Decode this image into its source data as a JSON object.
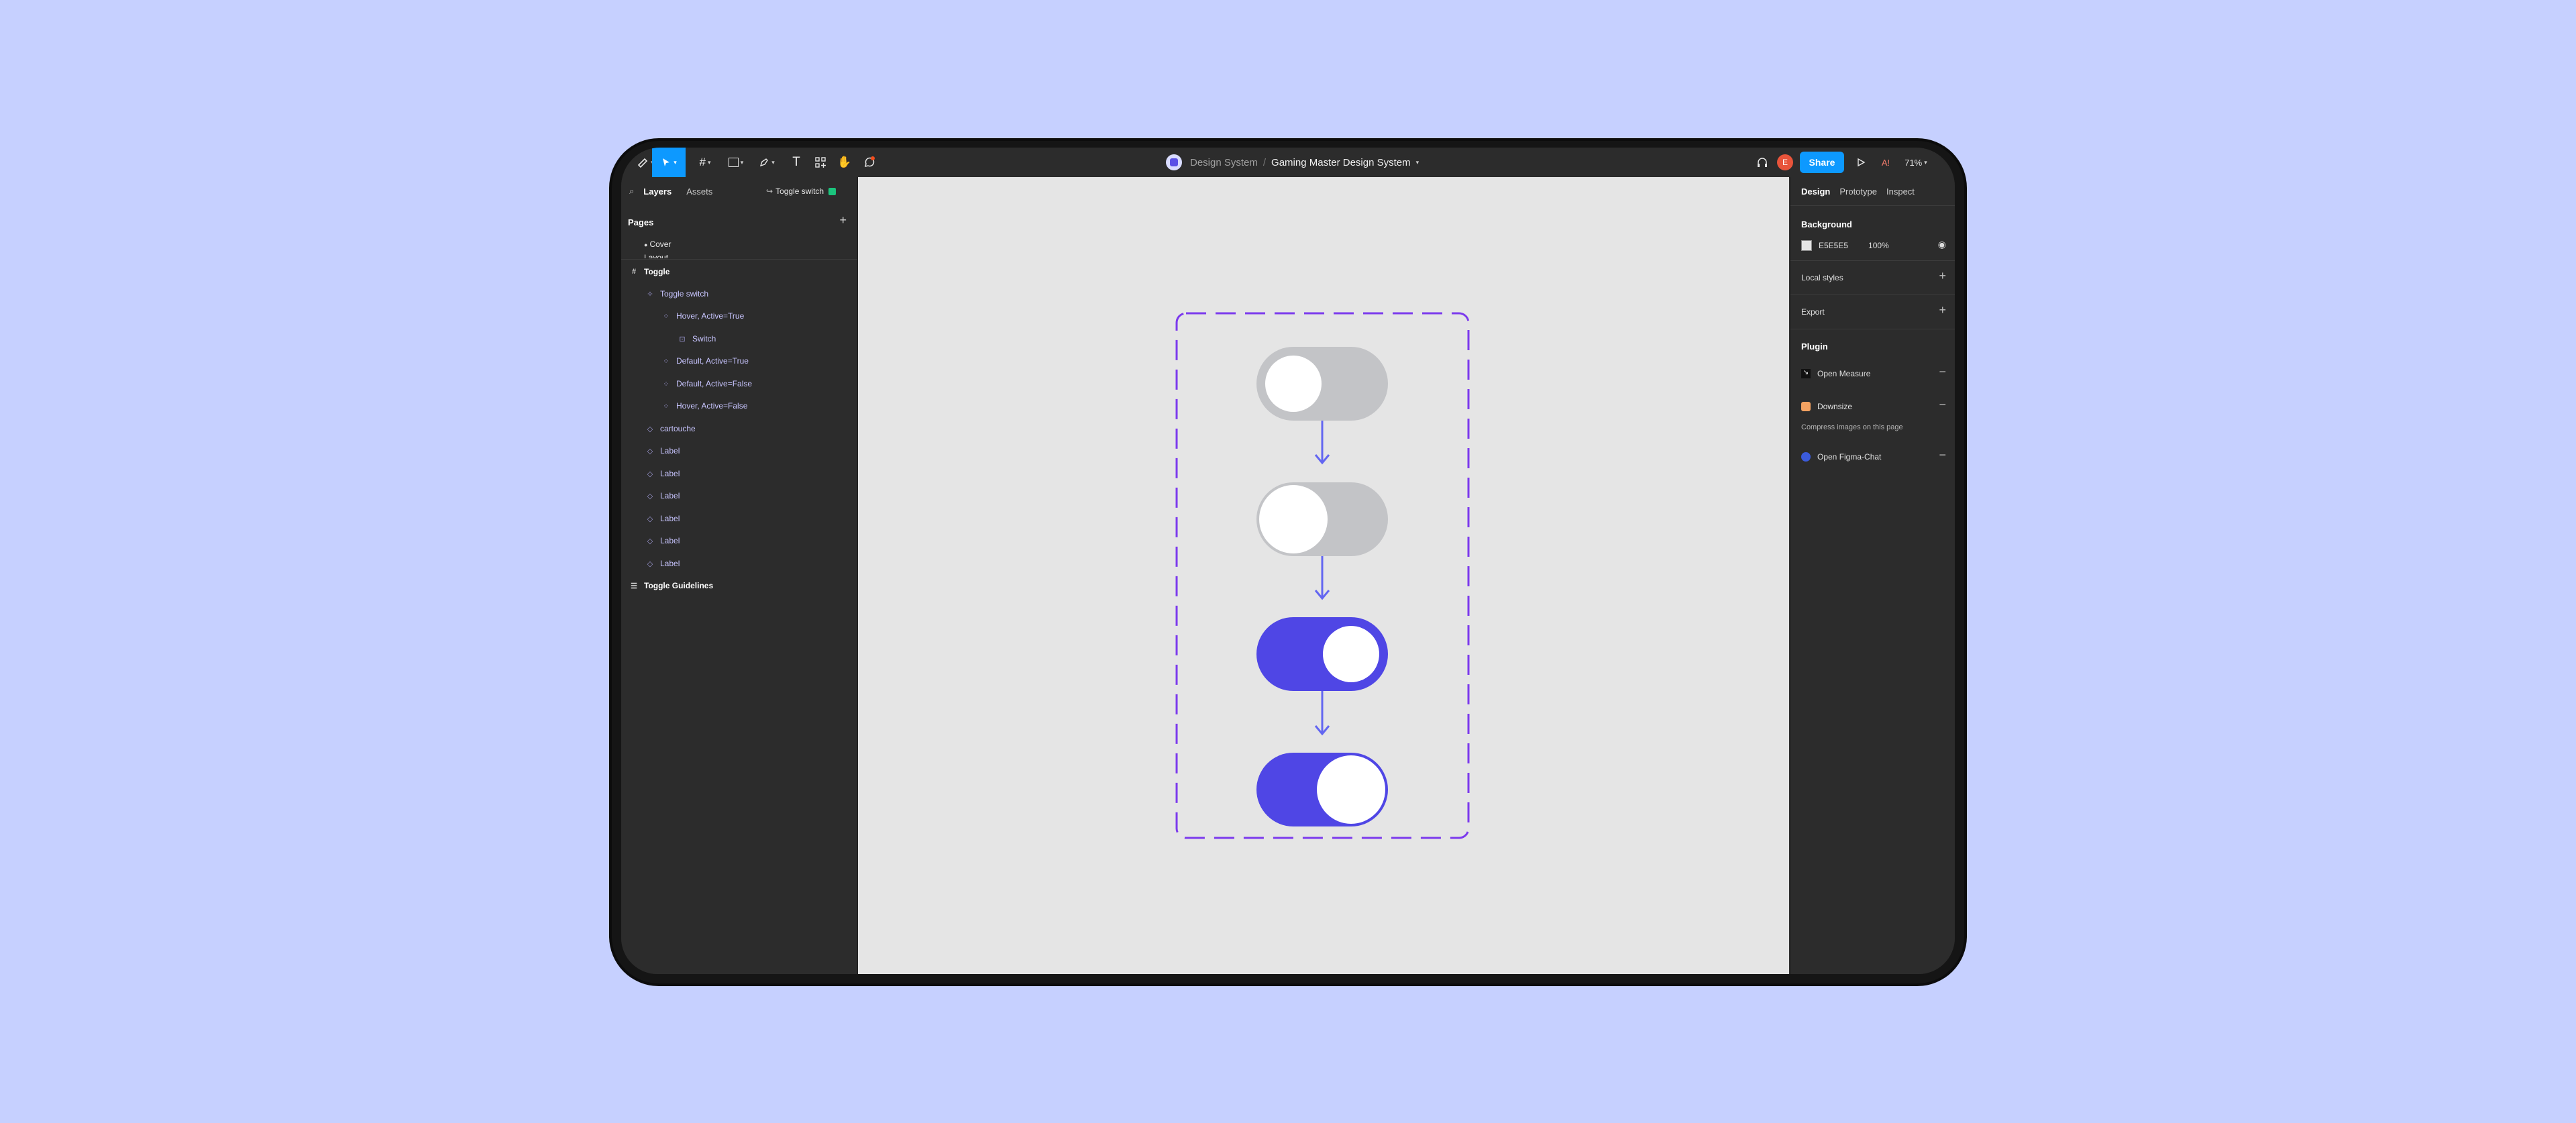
{
  "toolbar": {
    "project": "Design System",
    "separator": "/",
    "file_name": "Gaming Master Design System",
    "share_label": "Share",
    "avatar_initial": "E",
    "accessibility_label": "A!",
    "zoom": "71%"
  },
  "left_panel": {
    "tabs": {
      "layers": "Layers",
      "assets": "Assets"
    },
    "selection": "Toggle switch",
    "pages_heading": "Pages",
    "pages": [
      "Cover",
      "Layout"
    ],
    "layers": [
      {
        "label": "Toggle",
        "icon": "frame-icon"
      },
      {
        "label": "Toggle switch",
        "icon": "component-set-icon"
      },
      {
        "label": "Hover, Active=True",
        "icon": "variant-icon"
      },
      {
        "label": "Switch",
        "icon": "group-icon"
      },
      {
        "label": "Default, Active=True",
        "icon": "variant-icon"
      },
      {
        "label": "Default, Active=False",
        "icon": "variant-icon"
      },
      {
        "label": "Hover, Active=False",
        "icon": "variant-icon"
      },
      {
        "label": "cartouche",
        "icon": "instance-icon"
      },
      {
        "label": "Label",
        "icon": "instance-icon"
      },
      {
        "label": "Label",
        "icon": "instance-icon"
      },
      {
        "label": "Label",
        "icon": "instance-icon"
      },
      {
        "label": "Label",
        "icon": "instance-icon"
      },
      {
        "label": "Label",
        "icon": "instance-icon"
      },
      {
        "label": "Label",
        "icon": "instance-icon"
      },
      {
        "label": "Toggle Guidelines",
        "icon": "section-icon"
      }
    ]
  },
  "right_panel": {
    "tabs": {
      "design": "Design",
      "prototype": "Prototype",
      "inspect": "Inspect"
    },
    "background_heading": "Background",
    "background_hex": "E5E5E5",
    "background_opacity": "100%",
    "local_styles": "Local styles",
    "export": "Export",
    "plugin_heading": "Plugin",
    "plugins": {
      "open_measure": "Open Measure",
      "downsize": "Downsize",
      "downsize_desc": "Compress images on this page",
      "figma_chat": "Open Figma-Chat"
    }
  },
  "canvas": {
    "background": "#e5e5e5",
    "toggles": [
      {
        "variant": "Default, Active=False",
        "active": false
      },
      {
        "variant": "Hover, Active=False",
        "active": false
      },
      {
        "variant": "Default, Active=True",
        "active": true
      },
      {
        "variant": "Hover, Active=True",
        "active": true
      }
    ],
    "colors": {
      "off": "#c3c4c7",
      "on": "#4f46e5",
      "frame": "#7c3aed",
      "connector": "#6366f1"
    }
  }
}
